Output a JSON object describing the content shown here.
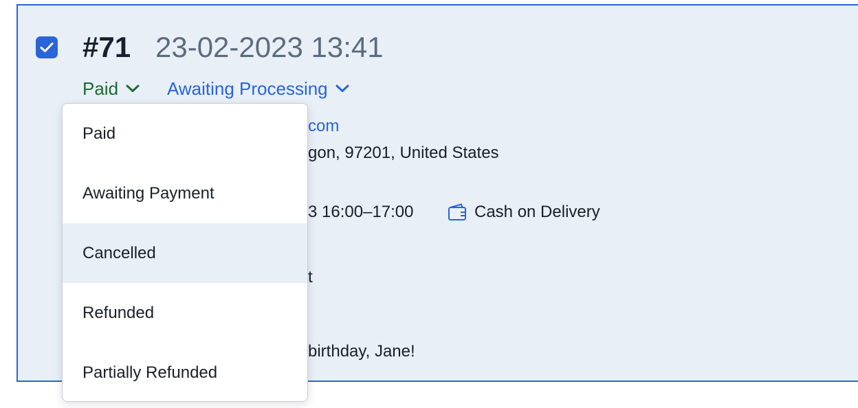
{
  "order": {
    "number": "#71",
    "datetime": "23-02-2023 13:41",
    "selected": true
  },
  "statuses": {
    "payment": "Paid",
    "fulfillment": "Awaiting Processing"
  },
  "details": {
    "email_fragment": "com",
    "address_fragment": "gon, 97201, United States",
    "delivery_time_fragment": "3 16:00–17:00",
    "payment_method": "Cash on Delivery",
    "misc_fragment": "t",
    "note_fragment": "birthday, Jane!"
  },
  "payment_dropdown": {
    "options": [
      "Paid",
      "Awaiting Payment",
      "Cancelled",
      "Refunded",
      "Partially Refunded"
    ],
    "hovered": "Cancelled"
  },
  "icons": {
    "checkbox": "checkmark-icon",
    "chevron": "chevron-down-icon",
    "wallet": "wallet-icon"
  },
  "colors": {
    "accent": "#2a64d6",
    "paid": "#1e6a32",
    "card_bg": "#e8eff7"
  }
}
